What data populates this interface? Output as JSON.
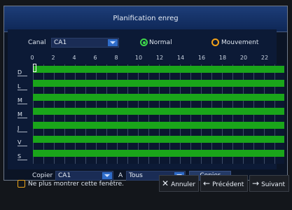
{
  "dialog": {
    "title": "Planification enreg"
  },
  "channel": {
    "label": "Canal",
    "value": "CA1"
  },
  "modes": {
    "normal": "Normal",
    "motion": "Mouvement"
  },
  "hours": [
    "0",
    "2",
    "4",
    "6",
    "8",
    "10",
    "12",
    "14",
    "16",
    "18",
    "20",
    "22"
  ],
  "days": [
    "D",
    "L",
    "M",
    "M",
    "J",
    "V",
    "S"
  ],
  "copy": {
    "label": "Copier",
    "from_value": "CA1",
    "to_label": "A",
    "to_value": "Tous",
    "button": "Copier"
  },
  "footer": {
    "checkbox_label": "Ne plus montrer cette fenêtre.",
    "cancel": "Annuler",
    "previous": "Précédent",
    "next": "Suivant"
  },
  "colors": {
    "schedule_normal": "#1aa51a",
    "normal_radio": "#3ed64a",
    "motion_radio": "#f2a21a"
  }
}
